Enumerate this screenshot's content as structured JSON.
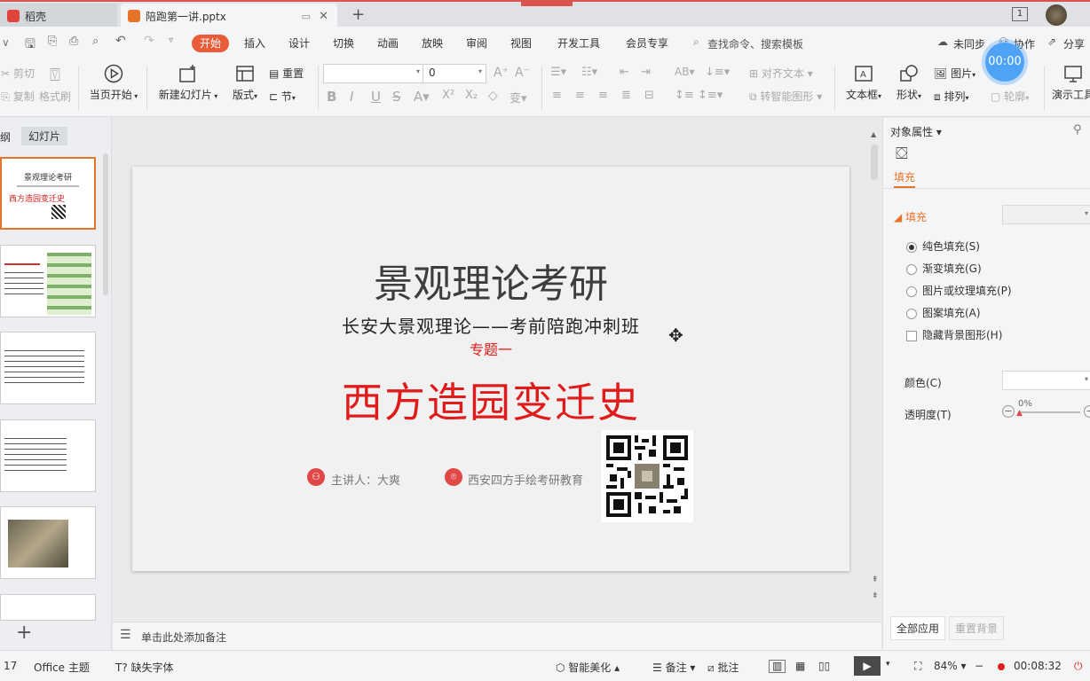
{
  "titlebar": {
    "tab1_label": "稻壳",
    "tab2_label": "陪跑第一讲.pptx",
    "new_tab_symbol": "+",
    "page_indicator": "1"
  },
  "menu": {
    "items": [
      "开始",
      "插入",
      "设计",
      "切换",
      "动画",
      "放映",
      "审阅",
      "视图",
      "开发工具",
      "会员专享"
    ],
    "search_placeholder": "查找命令、搜索模板",
    "sync": "未同步",
    "collab": "协作",
    "share": "分享"
  },
  "ribbon": {
    "cut": "剪切",
    "copy": "复制",
    "format_painter": "格式刷",
    "play_from_current": "当页开始",
    "new_slide": "新建幻灯片",
    "layout": "版式",
    "reset": "重置",
    "section": "节",
    "font_size": "0",
    "align_text": "对齐文本",
    "smartart": "转智能图形",
    "textbox": "文本框",
    "shape": "形状",
    "picture": "图片",
    "arrange": "排列",
    "outline": "轮廓",
    "presenter": "演示工具",
    "timer": "00:00"
  },
  "leftpanel": {
    "tab_outline": "纲",
    "tab_slides": "幻灯片",
    "add_symbol": "+"
  },
  "slide": {
    "title": "景观理论考研",
    "subtitle": "长安大景观理论——考前陪跑冲刺班",
    "topic_label": "专题一",
    "topic": "西方造园变迁史",
    "speaker": "主讲人：大爽",
    "org": "西安四方手绘考研教育"
  },
  "thumbs": {
    "t1_title": "景观理论考研",
    "t1_topic": "西方造园变迁史"
  },
  "notes": {
    "placeholder": "单击此处添加备注"
  },
  "rightpanel": {
    "header": "对象属性",
    "tab_fill": "填充",
    "section_fill": "填充",
    "options": [
      "纯色填充(S)",
      "渐变填充(G)",
      "图片或纹理填充(P)",
      "图案填充(A)"
    ],
    "hide_bg": "隐藏背景图形(H)",
    "color_label": "颜色(C)",
    "transparency_label": "透明度(T)",
    "transparency_value": "0%",
    "apply_all": "全部应用",
    "reset_bg": "重置背景"
  },
  "statusbar": {
    "slide_number": "17",
    "theme": "Office 主题",
    "missing_font": "缺失字体",
    "beautify": "智能美化",
    "notes": "备注",
    "comments": "批注",
    "zoom": "84%",
    "recording_time": "00:08:32"
  },
  "colors": {
    "accent": "#e85c3a",
    "slide_red": "#e01b1b",
    "pin_red": "#e04848"
  }
}
